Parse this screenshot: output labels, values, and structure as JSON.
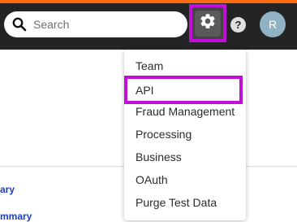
{
  "header": {
    "accent_color": "#ff6a13",
    "background_color": "#242424"
  },
  "search": {
    "placeholder": "Search",
    "icon": "search-icon"
  },
  "settings": {
    "icon": "gear-icon",
    "highlight_color": "#c10fd9"
  },
  "help": {
    "icon": "help-icon",
    "label": "?"
  },
  "avatar": {
    "initial": "R"
  },
  "background_links": [
    {
      "label": "ary"
    },
    {
      "label": "mmary"
    }
  ],
  "settings_menu": {
    "items": [
      {
        "label": "Team"
      },
      {
        "label": "API",
        "highlighted": true
      },
      {
        "label": "Fraud Management"
      },
      {
        "label": "Processing"
      },
      {
        "label": "Business"
      },
      {
        "label": "OAuth"
      },
      {
        "label": "Purge Test Data"
      }
    ]
  }
}
